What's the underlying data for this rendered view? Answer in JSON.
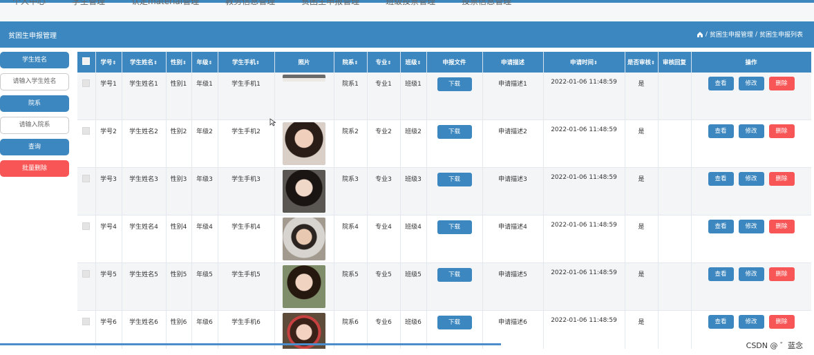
{
  "topnav": {
    "items": [
      "个人中心",
      "学生管理",
      "认定material管理",
      "教务信息管理",
      "贫困生申报管理",
      "班级投票管理",
      "投票信息管理"
    ]
  },
  "header": {
    "title": "贫困生申报管理",
    "breadcrumb": [
      "贫困生申报管理",
      "贫困生申报列表"
    ]
  },
  "sidebar": {
    "name_label": "学生姓名",
    "name_placeholder": "请输入学生姓名",
    "dept_label": "院系",
    "dept_placeholder": "请输入院系",
    "search_label": "查询",
    "batch_delete_label": "批量删除"
  },
  "table": {
    "headers": [
      "学号",
      "学生姓名",
      "性别",
      "年级",
      "学生手机",
      "照片",
      "院系",
      "专业",
      "班级",
      "申报文件",
      "申请描述",
      "申请时间",
      "是否审核",
      "审核回复",
      "操作"
    ],
    "rows": [
      {
        "id": "学号1",
        "name": "学生姓名1",
        "gender": "性别1",
        "grade": "年级1",
        "phone": "学生手机1",
        "dept": "院系1",
        "major": "专业1",
        "class": "班级1",
        "desc": "申请描述1",
        "time": "2022-01-06 11:48:59",
        "reviewed": "是",
        "reply": ""
      },
      {
        "id": "学号2",
        "name": "学生姓名2",
        "gender": "性别2",
        "grade": "年级2",
        "phone": "学生手机2",
        "dept": "院系2",
        "major": "专业2",
        "class": "班级2",
        "desc": "申请描述2",
        "time": "2022-01-06 11:48:59",
        "reviewed": "是",
        "reply": ""
      },
      {
        "id": "学号3",
        "name": "学生姓名3",
        "gender": "性别3",
        "grade": "年级3",
        "phone": "学生手机3",
        "dept": "院系3",
        "major": "专业3",
        "class": "班级3",
        "desc": "申请描述3",
        "time": "2022-01-06 11:48:59",
        "reviewed": "是",
        "reply": ""
      },
      {
        "id": "学号4",
        "name": "学生姓名4",
        "gender": "性别4",
        "grade": "年级4",
        "phone": "学生手机4",
        "dept": "院系4",
        "major": "专业4",
        "class": "班级4",
        "desc": "申请描述4",
        "time": "2022-01-06 11:48:59",
        "reviewed": "是",
        "reply": ""
      },
      {
        "id": "学号5",
        "name": "学生姓名5",
        "gender": "性别5",
        "grade": "年级5",
        "phone": "学生手机5",
        "dept": "院系5",
        "major": "专业5",
        "class": "班级5",
        "desc": "申请描述5",
        "time": "2022-01-06 11:48:59",
        "reviewed": "是",
        "reply": ""
      },
      {
        "id": "学号6",
        "name": "学生姓名6",
        "gender": "性别6",
        "grade": "年级6",
        "phone": "学生手机6",
        "dept": "院系6",
        "major": "专业6",
        "class": "班级6",
        "desc": "申请描述6",
        "time": "2022-01-06 11:48:59",
        "reviewed": "是",
        "reply": ""
      }
    ],
    "download_label": "下载",
    "view_label": "查看",
    "edit_label": "修改",
    "delete_label": "删除"
  },
  "watermark": "CSDN @ ゛蓝念",
  "colors": {
    "primary": "#3c87bf",
    "danger": "#f85656"
  }
}
